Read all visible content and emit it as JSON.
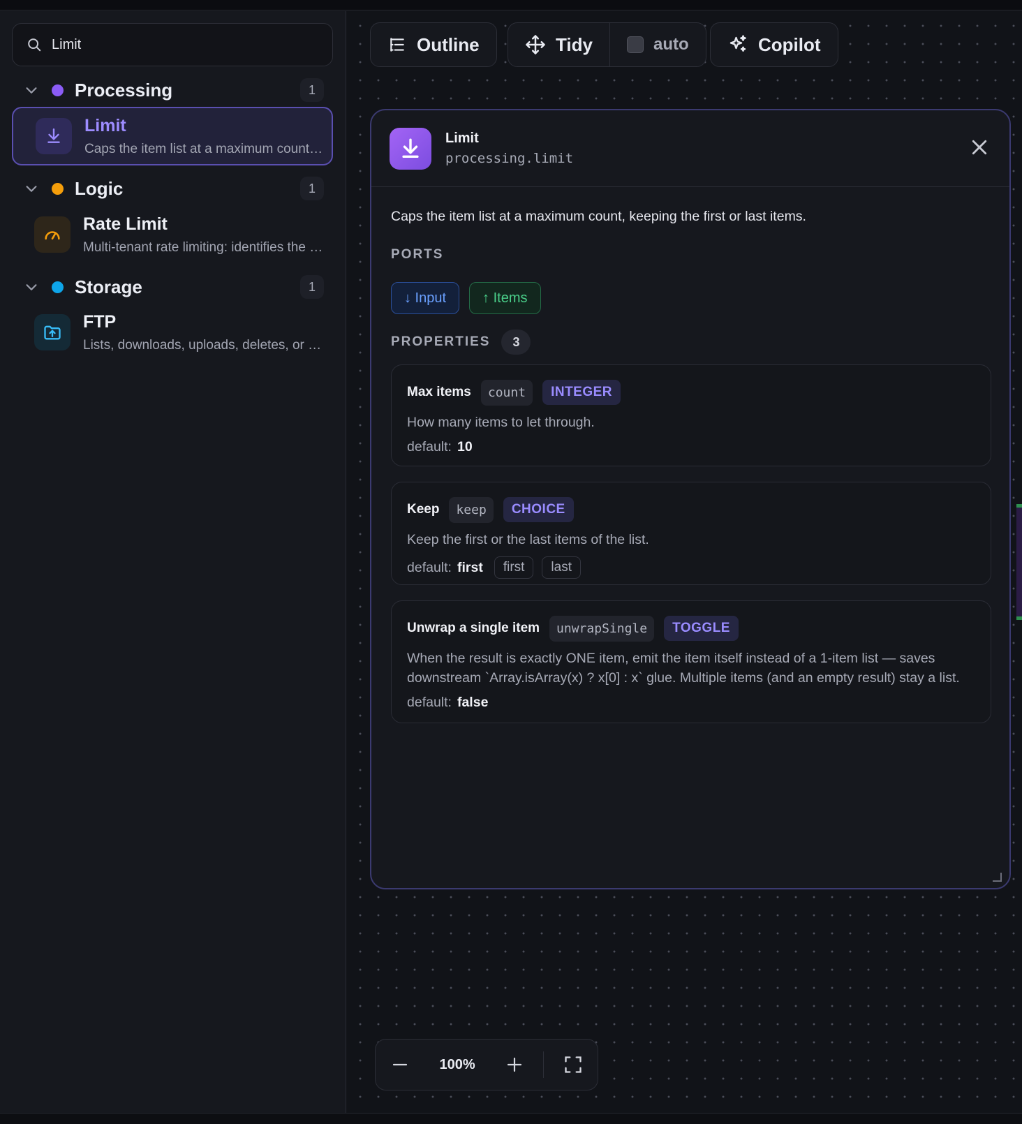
{
  "search": {
    "value": "Limit"
  },
  "groups": [
    {
      "name": "Processing",
      "count": "1",
      "color": "#8b5cf6"
    },
    {
      "name": "Logic",
      "count": "1",
      "color": "#f59e0b"
    },
    {
      "name": "Storage",
      "count": "1",
      "color": "#0ea5e9"
    }
  ],
  "items": [
    {
      "title": "Limit",
      "desc": "Caps the item list at a maximum count, keeping the first or last items.",
      "icon": "download-icon"
    },
    {
      "title": "Rate Limit",
      "desc": "Multi-tenant rate limiting: identifies the caller",
      "icon": "gauge-icon"
    },
    {
      "title": "FTP",
      "desc": "Lists, downloads, uploads, deletes, or moves files",
      "icon": "folder-upload-icon"
    }
  ],
  "toolbar": {
    "outline": "Outline",
    "tidy": "Tidy",
    "auto": "auto",
    "copilot": "Copilot"
  },
  "panel": {
    "title": "Limit",
    "subtitle": "processing.limit",
    "description": "Caps the item list at a maximum count, keeping the first or last items.",
    "ports_label": "PORTS",
    "port_in": "↓ Input",
    "port_out": "↑ Items",
    "properties_label": "PROPERTIES",
    "properties_count": "3",
    "properties": [
      {
        "name": "Max items",
        "key": "count",
        "type": "INTEGER",
        "desc": "How many items to let through.",
        "default_label": "default:",
        "default": "10"
      },
      {
        "name": "Keep",
        "key": "keep",
        "type": "CHOICE",
        "desc": "Keep the first or the last items of the list.",
        "default_label": "default:",
        "default": "first",
        "options": [
          "first",
          "last"
        ]
      },
      {
        "name": "Unwrap a single item",
        "key": "unwrapSingle",
        "type": "TOGGLE",
        "desc_line1": "When the result is exactly ONE item, emit the item itself instead of a 1-item list — saves",
        "desc_line2": "downstream `Array.isArray(x) ? x[0] : x` glue. Multiple items (and an empty result) stay a list.",
        "default_label": "default:",
        "default": "false"
      }
    ]
  },
  "zoom": {
    "value": "100%"
  }
}
